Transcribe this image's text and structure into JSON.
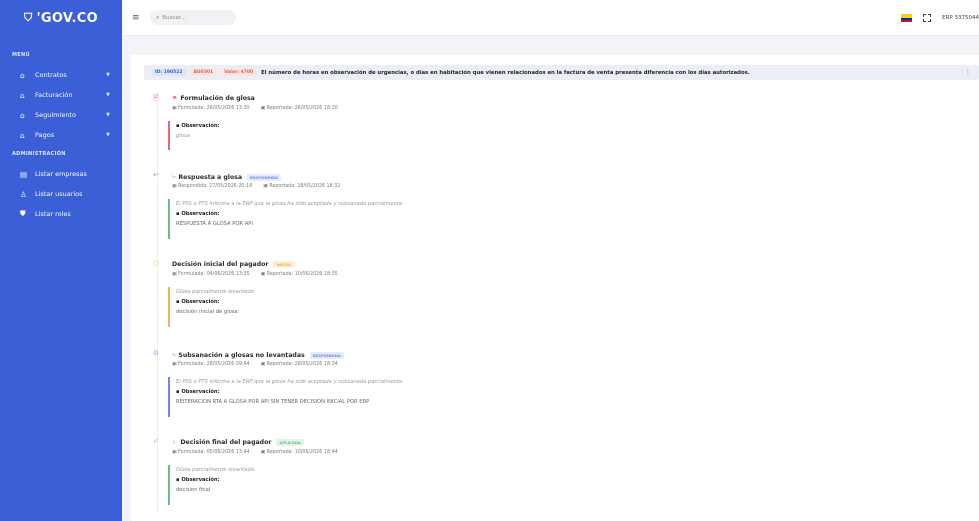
{
  "sidebar": {
    "logo": "'GOV.CO",
    "menu_label": "MENÚ",
    "items": [
      {
        "label": "Contratos"
      },
      {
        "label": "Facturación"
      },
      {
        "label": "Seguimiento"
      },
      {
        "label": "Pagos"
      }
    ],
    "admin_label": "ADMINISTRACIÓN",
    "admin_items": [
      {
        "label": "Listar empresas"
      },
      {
        "label": "Listar usuarios"
      },
      {
        "label": "Listar roles"
      }
    ]
  },
  "topbar": {
    "search_placeholder": "Buscar...",
    "erp": "ERP 3375044"
  },
  "glosa": {
    "id_badge": "ID: 190522",
    "code_badge": "AU0301",
    "value_badge": "Valor: $700",
    "title": "El número de horas en observación de urgencias, o días en habitación que vienen relacionados en la factura de venta presenta diferencia con los días autorizados."
  },
  "events": [
    {
      "title": "Formulación de glosa",
      "badge": "",
      "meta_a": "Formulada: 26/05/2026 13:30",
      "meta_b": "Reportada: 26/05/2026 18:30",
      "text": "",
      "obs_label": "Observación:",
      "obs_value": "glosa",
      "color": "#e8696b"
    },
    {
      "title": "Respuesta a glosa",
      "badge": "RESPONDIDA",
      "meta_a": "Respondida: 27/05/2026 20:18",
      "meta_b": "Reportada: 28/05/2026 18:32",
      "text": "El PSS o PTS informa a la ERP que la glosa ha sido aceptada y subsanada parcialmente.",
      "obs_label": "Observación:",
      "obs_value": "RESPUESTA A GLOSA POR API",
      "color": "#6dbd86"
    },
    {
      "title": "Decisión inicial del pagador",
      "badge": "INICIAL",
      "meta_a": "Formulada: 04/06/2026 13:35",
      "meta_b": "Reportada: 10/06/2026 18:35",
      "text": "Glosa parcialmente levantada",
      "obs_label": "Observación:",
      "obs_value": "decisión inicial de glosa",
      "color": "#e9b75a"
    },
    {
      "title": "Subsanación a glosas no levantadas",
      "badge": "RESPONDIDA",
      "meta_a": "Formulada: 28/05/2026 09:44",
      "meta_b": "Reportada: 28/05/2026 18:34",
      "text": "El PSS o PTS informa a la ERP que la glosa ha sido aceptada y subsanada parcialmente.",
      "obs_label": "Observación:",
      "obs_value": "REITERACION RTA A GLOSA POR API SIN TENER DECISION INICIAL POR ERP",
      "color": "#6e89e3"
    },
    {
      "title": "Decisión final del pagador",
      "badge": "APLICADA",
      "meta_a": "Formulada: 05/06/2026 13:44",
      "meta_b": "Reportada: 10/06/2026 18:44",
      "text": "Glosa parcialmente levantada",
      "obs_label": "Observación:",
      "obs_value": "decision final",
      "color": "#6dbd86"
    }
  ]
}
